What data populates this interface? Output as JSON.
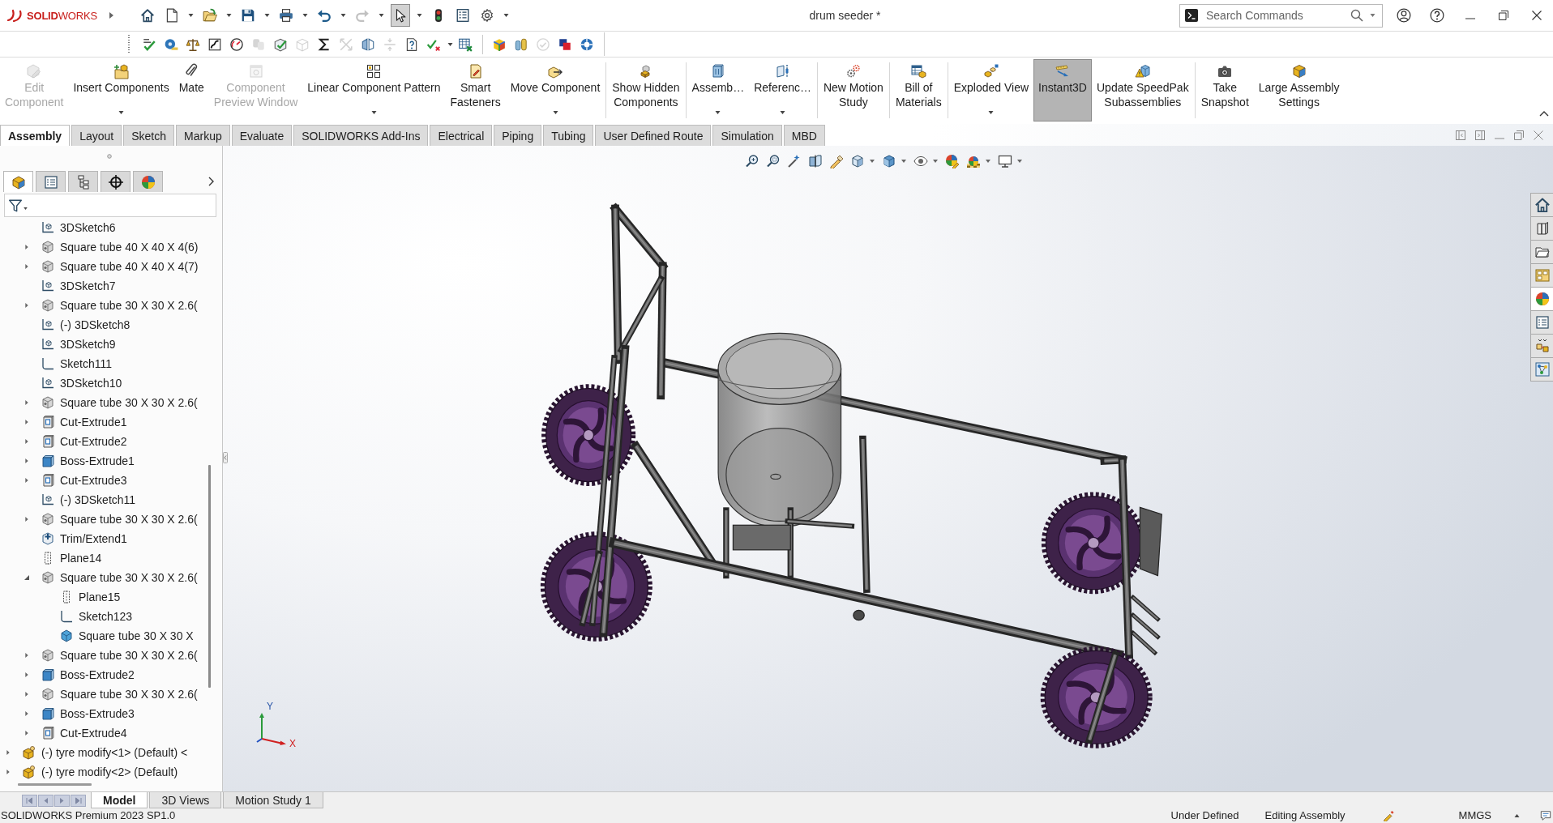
{
  "app": {
    "logo": "**SOLID**WORKS",
    "title": "drum seeder *"
  },
  "quick_access": [
    {
      "kind": "home",
      "dropdown": false,
      "disabled": false,
      "pressed": false
    },
    {
      "kind": "new",
      "dropdown": true,
      "disabled": false,
      "pressed": false
    },
    {
      "kind": "open",
      "dropdown": true,
      "disabled": false,
      "pressed": false
    },
    {
      "kind": "save",
      "dropdown": true,
      "disabled": false,
      "pressed": false
    },
    {
      "kind": "print",
      "dropdown": true,
      "disabled": false,
      "pressed": false
    },
    {
      "kind": "undo",
      "dropdown": true,
      "disabled": false,
      "pressed": false
    },
    {
      "kind": "redo",
      "dropdown": true,
      "disabled": true,
      "pressed": false
    },
    {
      "kind": "select",
      "dropdown": true,
      "disabled": false,
      "pressed": true
    },
    {
      "kind": "rebuild",
      "dropdown": false,
      "disabled": false,
      "pressed": false
    },
    {
      "kind": "fileproperties",
      "dropdown": false,
      "disabled": false,
      "pressed": false
    },
    {
      "kind": "options",
      "dropdown": true,
      "disabled": false,
      "pressed": false
    }
  ],
  "search": {
    "placeholder": "Search Commands"
  },
  "toolbar": {
    "groups": [
      {
        "items": [
          {
            "kind": "spellcheck",
            "disabled": false,
            "dropdown": false
          },
          {
            "kind": "measure",
            "disabled": false,
            "dropdown": false
          },
          {
            "kind": "massproperties",
            "disabled": false,
            "dropdown": false
          },
          {
            "kind": "sectioncurve",
            "disabled": false,
            "dropdown": false
          },
          {
            "kind": "sensor",
            "disabled": false,
            "dropdown": false
          },
          {
            "kind": "interference",
            "disabled": true,
            "dropdown": false
          },
          {
            "kind": "check",
            "disabled": false,
            "dropdown": false
          },
          {
            "kind": "geometryanalysis",
            "disabled": true,
            "dropdown": false
          },
          {
            "kind": "equations",
            "disabled": false,
            "dropdown": false
          },
          {
            "kind": "clearance",
            "disabled": true,
            "dropdown": false
          },
          {
            "kind": "symmetry",
            "disabled": false,
            "dropdown": false
          },
          {
            "kind": "align",
            "disabled": true,
            "dropdown": false
          },
          {
            "kind": "helpdocument",
            "disabled": false,
            "dropdown": false
          },
          {
            "kind": "tickcross",
            "disabled": false,
            "dropdown": true
          },
          {
            "kind": "spreadsheet",
            "disabled": false,
            "dropdown": false
          }
        ]
      },
      {
        "items": [
          {
            "kind": "multicolorpart",
            "disabled": false,
            "dropdown": false
          },
          {
            "kind": "cylinders",
            "disabled": false,
            "dropdown": false
          },
          {
            "kind": "circlecheck",
            "disabled": true,
            "dropdown": false
          },
          {
            "kind": "stackedsquares",
            "disabled": false,
            "dropdown": false
          },
          {
            "kind": "ring",
            "disabled": false,
            "dropdown": false
          }
        ]
      }
    ]
  },
  "ribbon": {
    "groups": [
      {
        "buttons": [
          {
            "kind": "editcomponent",
            "lines": [
              "Edit",
              "Component"
            ],
            "disabled": true,
            "dropdown": false,
            "pressed": false
          },
          {
            "kind": "insertcomponents",
            "lines": [
              "Insert Components"
            ],
            "disabled": false,
            "dropdown": true,
            "pressed": false
          },
          {
            "kind": "mate",
            "lines": [
              "Mate"
            ],
            "disabled": false,
            "dropdown": false,
            "pressed": false
          },
          {
            "kind": "componentpreview",
            "lines": [
              "Component",
              "Preview Window"
            ],
            "disabled": true,
            "dropdown": false,
            "pressed": false
          },
          {
            "kind": "linearpattern",
            "lines": [
              "Linear Component Pattern"
            ],
            "disabled": false,
            "dropdown": true,
            "pressed": false
          },
          {
            "kind": "smartfasteners",
            "lines": [
              "Smart",
              "Fasteners"
            ],
            "disabled": false,
            "dropdown": false,
            "pressed": false
          },
          {
            "kind": "movecomponent",
            "lines": [
              "Move Component"
            ],
            "disabled": false,
            "dropdown": true,
            "pressed": false
          }
        ]
      },
      {
        "buttons": [
          {
            "kind": "showhidden",
            "lines": [
              "Show Hidden",
              "Components"
            ],
            "disabled": false,
            "dropdown": false,
            "pressed": false
          }
        ]
      },
      {
        "buttons": [
          {
            "kind": "assemblyfeatures",
            "lines": [
              "Assemb…"
            ],
            "disabled": false,
            "dropdown": true,
            "pressed": false
          },
          {
            "kind": "referencegeometry",
            "lines": [
              "Referenc…"
            ],
            "disabled": false,
            "dropdown": true,
            "pressed": false
          }
        ]
      },
      {
        "buttons": [
          {
            "kind": "motionstudy",
            "lines": [
              "New Motion",
              "Study"
            ],
            "disabled": false,
            "dropdown": false,
            "pressed": false
          }
        ]
      },
      {
        "buttons": [
          {
            "kind": "billofmaterials",
            "lines": [
              "Bill of",
              "Materials"
            ],
            "disabled": false,
            "dropdown": false,
            "pressed": false
          }
        ]
      },
      {
        "buttons": [
          {
            "kind": "explodedview",
            "lines": [
              "Exploded View"
            ],
            "disabled": false,
            "dropdown": true,
            "pressed": false
          },
          {
            "kind": "instant3d",
            "lines": [
              "Instant3D"
            ],
            "disabled": false,
            "dropdown": false,
            "pressed": true
          },
          {
            "kind": "speedpak",
            "lines": [
              "Update SpeedPak",
              "Subassemblies"
            ],
            "disabled": false,
            "dropdown": false,
            "pressed": false
          }
        ]
      },
      {
        "buttons": [
          {
            "kind": "snapshot",
            "lines": [
              "Take",
              "Snapshot"
            ],
            "disabled": false,
            "dropdown": false,
            "pressed": false
          },
          {
            "kind": "largeassembly",
            "lines": [
              "Large Assembly",
              "Settings"
            ],
            "disabled": false,
            "dropdown": false,
            "pressed": false
          }
        ]
      }
    ]
  },
  "command_tabs": [
    {
      "label": "Assembly",
      "selected": true
    },
    {
      "label": "Layout",
      "selected": false
    },
    {
      "label": "Sketch",
      "selected": false
    },
    {
      "label": "Markup",
      "selected": false
    },
    {
      "label": "Evaluate",
      "selected": false
    },
    {
      "label": "SOLIDWORKS Add-Ins",
      "selected": false
    },
    {
      "label": "Electrical",
      "selected": false
    },
    {
      "label": "Piping",
      "selected": false
    },
    {
      "label": "Tubing",
      "selected": false
    },
    {
      "label": "User Defined Route",
      "selected": false
    },
    {
      "label": "Simulation",
      "selected": false
    },
    {
      "label": "MBD",
      "selected": false
    }
  ],
  "panel_tabs": [
    {
      "kind": "featuremanager",
      "selected": true
    },
    {
      "kind": "propertymanager",
      "selected": false
    },
    {
      "kind": "configurationmanager",
      "selected": false
    },
    {
      "kind": "dimxpert",
      "selected": false
    },
    {
      "kind": "displaymanager",
      "selected": false
    }
  ],
  "tree": [
    {
      "children": [
        {
          "label": "3DSketch6",
          "kind": "sketch3d",
          "expandable": false,
          "expanded": false
        },
        {
          "label": "Square tube 40 X 40 X 4(6)",
          "kind": "part",
          "expandable": true,
          "expanded": false
        },
        {
          "label": "Square tube 40 X 40 X 4(7)",
          "kind": "part",
          "expandable": true,
          "expanded": false
        },
        {
          "label": "3DSketch7",
          "kind": "sketch3d",
          "expandable": false,
          "expanded": false
        },
        {
          "label": "Square tube 30 X 30 X 2.6(",
          "kind": "part",
          "expandable": true,
          "expanded": false
        },
        {
          "label": "(-) 3DSketch8",
          "kind": "sketch3d",
          "expandable": false,
          "expanded": false
        },
        {
          "label": "3DSketch9",
          "kind": "sketch3d",
          "expandable": false,
          "expanded": false
        },
        {
          "label": "Sketch111",
          "kind": "sketch",
          "expandable": false,
          "expanded": false
        },
        {
          "label": "3DSketch10",
          "kind": "sketch3d",
          "expandable": false,
          "expanded": false
        },
        {
          "label": "Square tube 30 X 30 X 2.6(",
          "kind": "part",
          "expandable": true,
          "expanded": false
        },
        {
          "label": "Cut-Extrude1",
          "kind": "cut",
          "expandable": true,
          "expanded": false
        },
        {
          "label": "Cut-Extrude2",
          "kind": "cut",
          "expandable": true,
          "expanded": false
        },
        {
          "label": "Boss-Extrude1",
          "kind": "boss",
          "expandable": true,
          "expanded": false
        },
        {
          "label": "Cut-Extrude3",
          "kind": "cut",
          "expandable": true,
          "expanded": false
        },
        {
          "label": "(-) 3DSketch11",
          "kind": "sketch3d",
          "expandable": false,
          "expanded": false
        },
        {
          "label": "Square tube 30 X 30 X 2.6(",
          "kind": "part",
          "expandable": true,
          "expanded": false
        },
        {
          "label": "Trim/Extend1",
          "kind": "trim",
          "expandable": false,
          "expanded": false
        },
        {
          "label": "Plane14",
          "kind": "plane",
          "expandable": false,
          "expanded": false
        },
        {
          "label": "Square tube 30 X 30 X 2.6(",
          "kind": "part",
          "expandable": true,
          "expanded": true,
          "children": [
            {
              "label": "Plane15",
              "kind": "plane",
              "expandable": false,
              "expanded": false
            },
            {
              "label": "Sketch123",
              "kind": "sketch",
              "expandable": false,
              "expanded": false
            },
            {
              "label": "Square tube 30 X 30 X",
              "kind": "body",
              "expandable": false,
              "expanded": false
            }
          ]
        },
        {
          "label": "Square tube 30 X 30 X 2.6(",
          "kind": "part",
          "expandable": true,
          "expanded": false
        },
        {
          "label": "Boss-Extrude2",
          "kind": "boss",
          "expandable": true,
          "expanded": false
        },
        {
          "label": "Square tube 30 X 30 X 2.6(",
          "kind": "part",
          "expandable": true,
          "expanded": false
        },
        {
          "label": "Boss-Extrude3",
          "kind": "boss",
          "expandable": true,
          "expanded": false
        },
        {
          "label": "Cut-Extrude4",
          "kind": "cut",
          "expandable": true,
          "expanded": false
        }
      ]
    },
    {
      "label": "(-) tyre modify<1> (Default) <",
      "kind": "component",
      "expandable": true,
      "expanded": false
    },
    {
      "label": "(-) tyre modify<2> (Default)",
      "kind": "component",
      "expandable": true,
      "expanded": false
    }
  ],
  "view_toolbar": [
    {
      "kind": "zoomfit",
      "dropdown": false
    },
    {
      "kind": "zoomarea",
      "dropdown": false
    },
    {
      "kind": "previousview",
      "dropdown": false
    },
    {
      "kind": "sectionview",
      "dropdown": false
    },
    {
      "kind": "annotation",
      "dropdown": false
    },
    {
      "kind": "orientation",
      "dropdown": true
    },
    {
      "kind": "displaystyle",
      "dropdown": true
    },
    {
      "kind": "hideshow",
      "dropdown": true
    },
    {
      "kind": "appearance",
      "dropdown": false
    },
    {
      "kind": "scene",
      "dropdown": true
    },
    {
      "kind": "viewsettings",
      "dropdown": true
    }
  ],
  "task_pane_tabs": [
    {
      "kind": "resources",
      "selected": false
    },
    {
      "kind": "library",
      "selected": false
    },
    {
      "kind": "explorer",
      "selected": false
    },
    {
      "kind": "palette",
      "selected": false
    },
    {
      "kind": "appearances",
      "selected": true
    },
    {
      "kind": "properties",
      "selected": false
    },
    {
      "kind": "motion",
      "selected": false
    },
    {
      "kind": "forum",
      "selected": false
    }
  ],
  "triad": {
    "y_label": "Y",
    "x_label": "X"
  },
  "bottom_tabs": [
    {
      "label": "Model",
      "selected": true
    },
    {
      "label": "3D Views",
      "selected": false
    },
    {
      "label": "Motion Study 1",
      "selected": false
    }
  ],
  "status_bar": {
    "product": "SOLIDWORKS Premium 2023 SP1.0",
    "sketch_state": "Under Defined",
    "mode": "Editing Assembly",
    "units": "MMGS"
  }
}
